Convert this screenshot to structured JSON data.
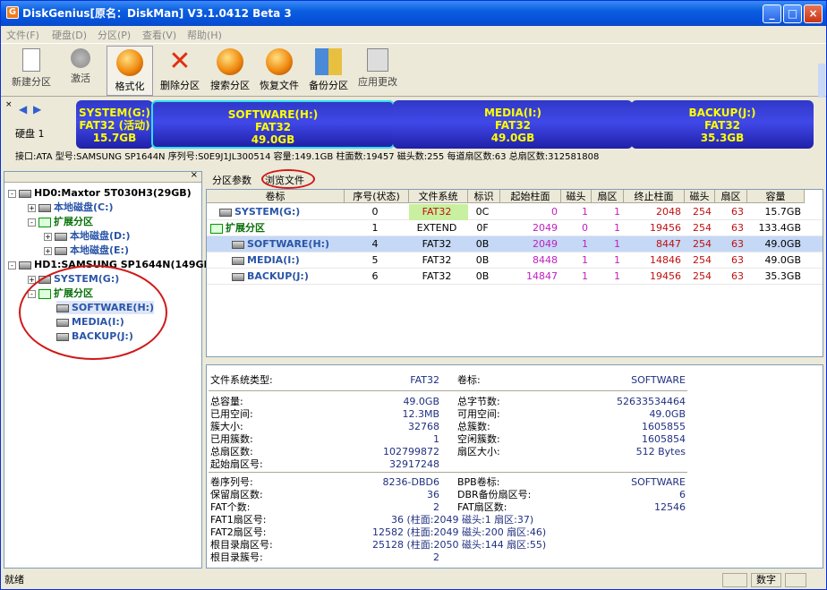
{
  "window": {
    "title": "DiskGenius[原名：DiskMan] V3.1.0412 Beta 3",
    "icon": "G"
  },
  "menus": [
    "文件(F)",
    "硬盘(D)",
    "分区(P)",
    "查看(V)",
    "帮助(H)"
  ],
  "toolbar": [
    "新建分区",
    "激活",
    "格式化",
    "删除分区",
    "搜索分区",
    "恢复文件",
    "备份分区",
    "应用更改"
  ],
  "diskmap": {
    "label": "硬盘 1",
    "segments": [
      {
        "name": "SYSTEM(G:)",
        "fs": "FAT32 (活动)",
        "size": "15.7GB"
      },
      {
        "name": "SOFTWARE(H:)",
        "fs": "FAT32",
        "size": "49.0GB"
      },
      {
        "name": "MEDIA(I:)",
        "fs": "FAT32",
        "size": "49.0GB"
      },
      {
        "name": "BACKUP(J:)",
        "fs": "FAT32",
        "size": "35.3GB"
      }
    ]
  },
  "diskinfo": "接口:ATA  型号:SAMSUNG SP1644N  序列号:S0E9J1JL300514  容量:149.1GB  柱面数:19457  磁头数:255  每道扇区数:63  总扇区数:312581808",
  "tree": [
    {
      "text": "HD0:Maxtor 5T030H3(29GB)",
      "level": 0
    },
    {
      "text": "本地磁盘(C:)",
      "level": 1
    },
    {
      "text": "扩展分区",
      "level": 1
    },
    {
      "text": "本地磁盘(D:)",
      "level": 2
    },
    {
      "text": "本地磁盘(E:)",
      "level": 2
    },
    {
      "text": "HD1:SAMSUNG SP1644N(149GB",
      "level": 0
    },
    {
      "text": "SYSTEM(G:)",
      "level": 1
    },
    {
      "text": "扩展分区",
      "level": 1
    },
    {
      "text": "SOFTWARE(H:)",
      "level": 2
    },
    {
      "text": "MEDIA(I:)",
      "level": 2
    },
    {
      "text": "BACKUP(J:)",
      "level": 2
    }
  ],
  "tabs": [
    "分区参数",
    "浏览文件"
  ],
  "columns": [
    "卷标",
    "序号(状态)",
    "文件系统",
    "标识",
    "起始柱面",
    "磁头",
    "扇区",
    "终止柱面",
    "磁头",
    "扇区",
    "容量"
  ],
  "rows": [
    [
      "SYSTEM(G:)",
      "0",
      "FAT32",
      "0C",
      "0",
      "1",
      "1",
      "2048",
      "254",
      "63",
      "15.7GB"
    ],
    [
      "扩展分区",
      "1",
      "EXTEND",
      "0F",
      "2049",
      "0",
      "1",
      "19456",
      "254",
      "63",
      "133.4GB"
    ],
    [
      "SOFTWARE(H:)",
      "4",
      "FAT32",
      "0B",
      "2049",
      "1",
      "1",
      "8447",
      "254",
      "63",
      "49.0GB"
    ],
    [
      "MEDIA(I:)",
      "5",
      "FAT32",
      "0B",
      "8448",
      "1",
      "1",
      "14846",
      "254",
      "63",
      "49.0GB"
    ],
    [
      "BACKUP(J:)",
      "6",
      "FAT32",
      "0B",
      "14847",
      "1",
      "1",
      "19456",
      "254",
      "63",
      "35.3GB"
    ]
  ],
  "details": {
    "fs_label": "文件系统类型:",
    "fs_value": "FAT32",
    "vol_label": "卷标:",
    "vol_value": "SOFTWARE",
    "g1": [
      [
        "总容量:",
        "49.0GB",
        "总字节数:",
        "52633534464"
      ],
      [
        "已用空间:",
        "12.3MB",
        "可用空间:",
        "49.0GB"
      ],
      [
        "簇大小:",
        "32768",
        "总簇数:",
        "1605855"
      ],
      [
        "已用簇数:",
        "1",
        "空闲簇数:",
        "1605854"
      ],
      [
        "总扇区数:",
        "102799872",
        "扇区大小:",
        "512 Bytes"
      ],
      [
        "起始扇区号:",
        "32917248",
        "",
        ""
      ]
    ],
    "g2": [
      [
        "卷序列号:",
        "8236-DBD6",
        "BPB卷标:",
        "SOFTWARE"
      ],
      [
        "保留扇区数:",
        "36",
        "DBR备份扇区号:",
        "6"
      ],
      [
        "FAT个数:",
        "2",
        "FAT扇区数:",
        "12546"
      ],
      [
        "FAT1扇区号:",
        "36 (柱面:2049 磁头:1 扇区:37)",
        "",
        ""
      ],
      [
        "FAT2扇区号:",
        "12582 (柱面:2049 磁头:200 扇区:46)",
        "",
        ""
      ],
      [
        "根目录扇区号:",
        "25128 (柱面:2050 磁头:144 扇区:55)",
        "",
        ""
      ],
      [
        "根目录簇号:",
        "2",
        "",
        ""
      ]
    ]
  },
  "status": {
    "left": "就绪",
    "right": "数字"
  }
}
